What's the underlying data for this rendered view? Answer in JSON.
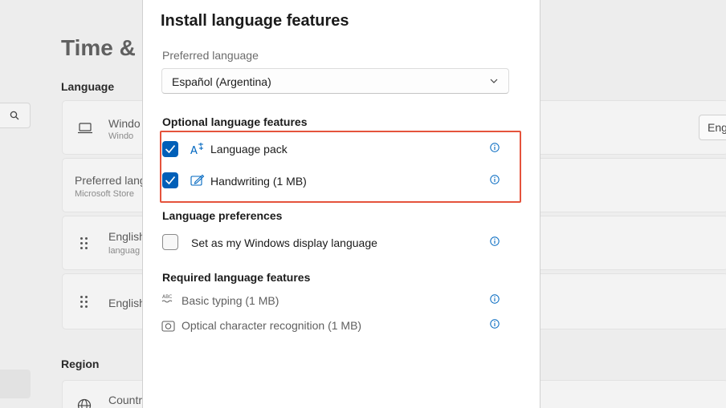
{
  "background": {
    "title": "Time & l",
    "section_language": "Language",
    "section_region": "Region",
    "cards": [
      {
        "title": "Windo",
        "subtitle": "Windo"
      },
      {
        "title": "Preferred lang",
        "subtitle": "Microsoft Store"
      },
      {
        "title": "English",
        "subtitle": "languag"
      },
      {
        "title": "English",
        "subtitle": ""
      },
      {
        "title": "Countr",
        "subtitle": ""
      }
    ],
    "english_button": "Eng"
  },
  "dialog": {
    "title": "Install language features",
    "preferred_label": "Preferred language",
    "preferred_value": "Español (Argentina)",
    "optional_header": "Optional language features",
    "optional_items": [
      {
        "label": "Language pack",
        "checked": true,
        "icon": "language-pack-icon"
      },
      {
        "label": "Handwriting (1 MB)",
        "checked": true,
        "icon": "handwriting-icon"
      }
    ],
    "preferences_header": "Language preferences",
    "preference_item": {
      "label": "Set as my Windows display language",
      "checked": false
    },
    "required_header": "Required language features",
    "required_items": [
      {
        "label": "Basic typing (1 MB)",
        "icon": "basic-typing-icon",
        "icon_text": "ABC"
      },
      {
        "label": "Optical character recognition (1 MB)",
        "icon": "ocr-icon"
      }
    ]
  },
  "colors": {
    "accent": "#005fb8",
    "highlight_border": "#e5533c",
    "info_icon": "#0067c0"
  }
}
